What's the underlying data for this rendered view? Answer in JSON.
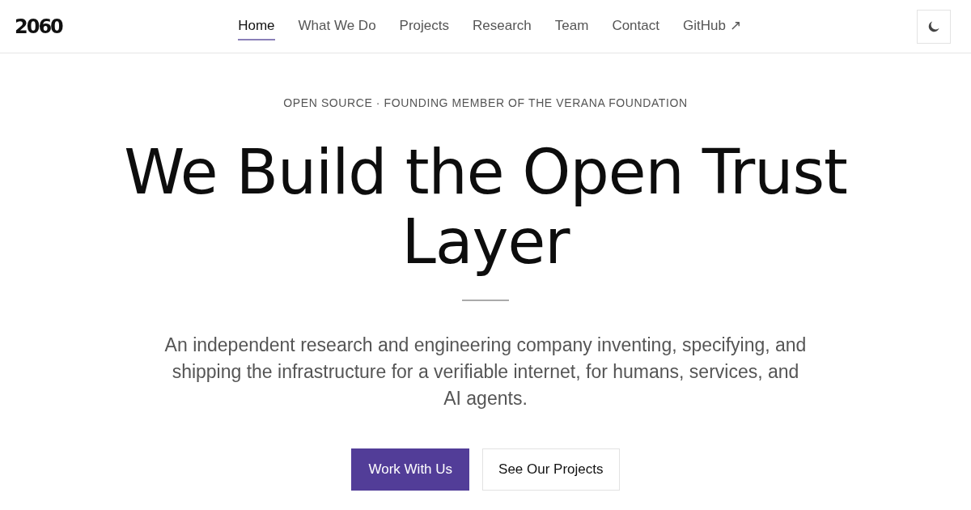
{
  "logo": "2060",
  "nav": [
    {
      "label": "Home",
      "selected": true
    },
    {
      "label": "What We Do",
      "selected": false
    },
    {
      "label": "Projects",
      "selected": false
    },
    {
      "label": "Research",
      "selected": false
    },
    {
      "label": "Team",
      "selected": false
    },
    {
      "label": "Contact",
      "selected": false
    },
    {
      "label": "GitHub ↗",
      "selected": false
    }
  ],
  "hero": {
    "eyebrow": "OPEN SOURCE · FOUNDING MEMBER OF THE VERANA FOUNDATION",
    "title": "We Build the Open Trust Layer",
    "lead": "An independent research and engineering company inventing, specifying, and shipping the infrastructure for a verifiable internet, for humans, services, and AI agents.",
    "buttons": [
      {
        "label": "Work With Us",
        "kind": "primary"
      },
      {
        "label": "See Our Projects",
        "kind": "outline"
      }
    ]
  }
}
